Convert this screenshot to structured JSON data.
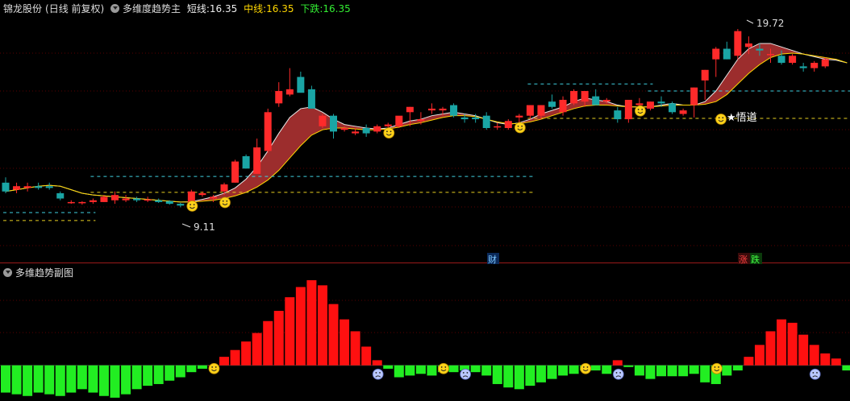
{
  "header": {
    "stock_name": "锦龙股份",
    "period": "(日线 前复权)",
    "indicator": "多维度趋势主",
    "short_label": "短线:",
    "short_value": "16.35",
    "mid_label": "中线:",
    "mid_value": "16.35",
    "down_label": "下跌:",
    "down_value": "16.35"
  },
  "sub_header": {
    "indicator": "多维趋势副图"
  },
  "annotations": {
    "high_label": "19.72",
    "low_label": "9.11",
    "star_label": "★悟道",
    "cai_marker": "财",
    "zhang_marker": "涨",
    "die_marker": "跌"
  },
  "colors": {
    "up": "#ff2a2a",
    "down": "#1aa5a5",
    "bar_up": "#ff1010",
    "bar_down": "#22ee22",
    "band": "#9c2d2d"
  },
  "chart_data": [
    {
      "type": "candlestick",
      "title": "锦龙股份 (日线 前复权)",
      "ylim": [
        7.2,
        21.0
      ],
      "candles": [
        {
          "o": 11.0,
          "h": 11.3,
          "l": 10.4,
          "c": 10.5
        },
        {
          "o": 10.6,
          "h": 11.0,
          "l": 10.4,
          "c": 10.8
        },
        {
          "o": 10.7,
          "h": 11.0,
          "l": 10.5,
          "c": 10.8
        },
        {
          "o": 10.8,
          "h": 11.0,
          "l": 10.6,
          "c": 10.7
        },
        {
          "o": 10.8,
          "h": 11.0,
          "l": 10.6,
          "c": 10.7
        },
        {
          "o": 10.4,
          "h": 10.5,
          "l": 10.0,
          "c": 10.1
        },
        {
          "o": 9.9,
          "h": 10.0,
          "l": 9.8,
          "c": 9.9
        },
        {
          "o": 9.85,
          "h": 9.95,
          "l": 9.75,
          "c": 9.9
        },
        {
          "o": 9.9,
          "h": 10.1,
          "l": 9.8,
          "c": 10.0
        },
        {
          "o": 9.9,
          "h": 10.3,
          "l": 9.9,
          "c": 10.2
        },
        {
          "o": 10.0,
          "h": 10.5,
          "l": 9.8,
          "c": 10.3
        },
        {
          "o": 10.0,
          "h": 10.3,
          "l": 9.9,
          "c": 10.1
        },
        {
          "o": 10.1,
          "h": 10.2,
          "l": 9.9,
          "c": 10.0
        },
        {
          "o": 10.0,
          "h": 10.2,
          "l": 9.9,
          "c": 10.05
        },
        {
          "o": 10.0,
          "h": 10.1,
          "l": 9.85,
          "c": 9.9
        },
        {
          "o": 9.95,
          "h": 10.0,
          "l": 9.75,
          "c": 9.8
        },
        {
          "o": 9.8,
          "h": 9.85,
          "l": 9.6,
          "c": 9.7
        },
        {
          "o": 9.7,
          "h": 10.6,
          "l": 9.6,
          "c": 10.5
        },
        {
          "o": 10.3,
          "h": 10.5,
          "l": 10.2,
          "c": 10.4
        },
        {
          "o": 10.1,
          "h": 10.3,
          "l": 9.9,
          "c": 10.2
        },
        {
          "o": 10.5,
          "h": 11.0,
          "l": 10.3,
          "c": 10.9
        },
        {
          "o": 11.0,
          "h": 12.3,
          "l": 11.0,
          "c": 12.2
        },
        {
          "o": 12.5,
          "h": 12.6,
          "l": 11.8,
          "c": 11.8
        },
        {
          "o": 11.5,
          "h": 13.5,
          "l": 11.5,
          "c": 13.0
        },
        {
          "o": 12.8,
          "h": 15.2,
          "l": 12.7,
          "c": 15.0
        },
        {
          "o": 15.5,
          "h": 16.7,
          "l": 15.3,
          "c": 16.2
        },
        {
          "o": 16.0,
          "h": 17.5,
          "l": 15.9,
          "c": 16.3
        },
        {
          "o": 17.0,
          "h": 17.3,
          "l": 16.2,
          "c": 16.1
        },
        {
          "o": 16.3,
          "h": 16.5,
          "l": 15.2,
          "c": 15.2
        },
        {
          "o": 14.2,
          "h": 14.9,
          "l": 14.1,
          "c": 14.8
        },
        {
          "o": 14.8,
          "h": 14.9,
          "l": 13.5,
          "c": 13.9
        },
        {
          "o": 14.0,
          "h": 14.2,
          "l": 13.9,
          "c": 14.1
        },
        {
          "o": 13.8,
          "h": 14.1,
          "l": 13.7,
          "c": 13.9
        },
        {
          "o": 14.1,
          "h": 14.3,
          "l": 13.6,
          "c": 13.8
        },
        {
          "o": 13.9,
          "h": 14.3,
          "l": 13.8,
          "c": 14.2
        },
        {
          "o": 14.2,
          "h": 14.4,
          "l": 14.0,
          "c": 14.3
        },
        {
          "o": 14.2,
          "h": 14.7,
          "l": 14.1,
          "c": 14.8
        },
        {
          "o": 15.0,
          "h": 15.3,
          "l": 14.2,
          "c": 15.3
        },
        {
          "o": 14.5,
          "h": 15.0,
          "l": 14.3,
          "c": 14.6
        },
        {
          "o": 15.1,
          "h": 15.5,
          "l": 14.9,
          "c": 15.2
        },
        {
          "o": 15.1,
          "h": 15.3,
          "l": 14.8,
          "c": 15.2
        },
        {
          "o": 15.4,
          "h": 15.5,
          "l": 14.7,
          "c": 14.8
        },
        {
          "o": 14.7,
          "h": 14.9,
          "l": 14.4,
          "c": 14.6
        },
        {
          "o": 14.7,
          "h": 14.9,
          "l": 14.4,
          "c": 14.6
        },
        {
          "o": 14.8,
          "h": 15.0,
          "l": 14.0,
          "c": 14.1
        },
        {
          "o": 14.2,
          "h": 14.4,
          "l": 14.0,
          "c": 14.2
        },
        {
          "o": 14.1,
          "h": 14.6,
          "l": 14.0,
          "c": 14.5
        },
        {
          "o": 14.7,
          "h": 14.9,
          "l": 14.4,
          "c": 14.8
        },
        {
          "o": 14.8,
          "h": 15.4,
          "l": 14.6,
          "c": 15.4
        },
        {
          "o": 14.8,
          "h": 15.4,
          "l": 14.6,
          "c": 15.4
        },
        {
          "o": 15.6,
          "h": 16.0,
          "l": 15.2,
          "c": 15.3
        },
        {
          "o": 15.0,
          "h": 15.9,
          "l": 14.8,
          "c": 15.7
        },
        {
          "o": 15.5,
          "h": 16.3,
          "l": 15.4,
          "c": 16.2
        },
        {
          "o": 15.6,
          "h": 16.2,
          "l": 15.3,
          "c": 16.2
        },
        {
          "o": 15.9,
          "h": 16.3,
          "l": 15.4,
          "c": 15.4
        },
        {
          "o": 15.6,
          "h": 15.8,
          "l": 15.5,
          "c": 15.7
        },
        {
          "o": 15.1,
          "h": 15.3,
          "l": 14.4,
          "c": 14.6
        },
        {
          "o": 14.6,
          "h": 15.6,
          "l": 14.4,
          "c": 15.7
        },
        {
          "o": 15.4,
          "h": 15.8,
          "l": 15.3,
          "c": 15.5
        },
        {
          "o": 15.2,
          "h": 15.6,
          "l": 15.1,
          "c": 15.6
        },
        {
          "o": 15.6,
          "h": 15.9,
          "l": 15.3,
          "c": 15.5
        },
        {
          "o": 15.5,
          "h": 15.6,
          "l": 14.9,
          "c": 15.0
        },
        {
          "o": 14.9,
          "h": 15.2,
          "l": 14.8,
          "c": 15.1
        },
        {
          "o": 15.4,
          "h": 16.4,
          "l": 14.7,
          "c": 16.4
        },
        {
          "o": 16.8,
          "h": 17.4,
          "l": 15.7,
          "c": 17.4
        },
        {
          "o": 18.0,
          "h": 18.7,
          "l": 17.0,
          "c": 18.6
        },
        {
          "o": 18.6,
          "h": 19.0,
          "l": 18.0,
          "c": 18.0
        },
        {
          "o": 18.2,
          "h": 19.72,
          "l": 18.0,
          "c": 19.6
        },
        {
          "o": 18.7,
          "h": 19.3,
          "l": 18.3,
          "c": 18.9
        },
        {
          "o": 18.6,
          "h": 18.9,
          "l": 18.2,
          "c": 18.5
        },
        {
          "o": 18.3,
          "h": 18.6,
          "l": 17.8,
          "c": 18.3
        },
        {
          "o": 18.2,
          "h": 18.5,
          "l": 17.7,
          "c": 17.8
        },
        {
          "o": 17.8,
          "h": 18.3,
          "l": 17.7,
          "c": 18.2
        },
        {
          "o": 17.6,
          "h": 17.8,
          "l": 17.3,
          "c": 17.5
        },
        {
          "o": 17.5,
          "h": 17.9,
          "l": 17.3,
          "c": 17.8
        },
        {
          "o": 17.6,
          "h": 18.1,
          "l": 17.5,
          "c": 18.0
        }
      ],
      "fast_line": [
        10.5,
        10.6,
        10.7,
        10.8,
        10.85,
        10.8,
        10.6,
        10.4,
        10.3,
        10.25,
        10.2,
        10.15,
        10.1,
        10.05,
        10.0,
        9.95,
        9.9,
        9.92,
        10.05,
        10.2,
        10.4,
        10.7,
        11.2,
        11.9,
        12.8,
        13.8,
        14.7,
        15.2,
        15.3,
        15.0,
        14.6,
        14.3,
        14.2,
        14.1,
        14.05,
        14.1,
        14.3,
        14.5,
        14.6,
        14.8,
        14.9,
        15.0,
        14.9,
        14.8,
        14.6,
        14.4,
        14.3,
        14.4,
        14.6,
        14.9,
        15.1,
        15.3,
        15.6,
        15.8,
        15.7,
        15.6,
        15.4,
        15.3,
        15.3,
        15.3,
        15.4,
        15.5,
        15.4,
        15.4,
        15.6,
        16.2,
        17.1,
        18.0,
        18.6,
        18.9,
        18.9,
        18.7,
        18.5,
        18.3,
        18.15,
        18.0,
        17.95,
        17.8
      ],
      "slow_line": [
        10.5,
        10.6,
        10.7,
        10.8,
        10.85,
        10.8,
        10.6,
        10.4,
        10.3,
        10.25,
        10.2,
        10.15,
        10.1,
        10.05,
        10.0,
        9.95,
        9.9,
        9.9,
        9.95,
        10.0,
        10.1,
        10.25,
        10.45,
        10.75,
        11.15,
        11.7,
        12.4,
        13.1,
        13.7,
        14.0,
        14.1,
        14.1,
        14.05,
        14.0,
        14.0,
        14.05,
        14.15,
        14.3,
        14.4,
        14.55,
        14.7,
        14.8,
        14.8,
        14.75,
        14.6,
        14.45,
        14.35,
        14.35,
        14.45,
        14.6,
        14.8,
        15.0,
        15.2,
        15.35,
        15.4,
        15.4,
        15.35,
        15.3,
        15.3,
        15.3,
        15.35,
        15.4,
        15.4,
        15.4,
        15.45,
        15.6,
        16.0,
        16.6,
        17.2,
        17.7,
        18.1,
        18.3,
        18.35,
        18.3,
        18.2,
        18.1,
        18.0,
        17.8
      ],
      "dashed_levels": [
        {
          "value": 9.3,
          "from": 0,
          "to": 8,
          "color": "cyan"
        },
        {
          "value": 8.85,
          "from": 0,
          "to": 8,
          "color": "yellow"
        },
        {
          "value": 11.35,
          "from": 8,
          "to": 48,
          "color": "cyan"
        },
        {
          "value": 10.45,
          "from": 8,
          "to": 48,
          "color": "yellow"
        },
        {
          "value": 16.6,
          "from": 48,
          "to": 59,
          "color": "cyan"
        },
        {
          "value": 16.2,
          "from": 59,
          "to": 78,
          "color": "cyan"
        },
        {
          "value": 14.65,
          "from": 48,
          "to": 78,
          "color": "yellow"
        }
      ],
      "smile_markers": [
        17,
        20,
        35,
        47,
        58
      ],
      "high": 19.72,
      "low": 9.11
    },
    {
      "type": "bar",
      "title": "多维趋势副图",
      "ylim": [
        -10,
        25
      ],
      "values": [
        -8,
        -8.5,
        -9,
        -8,
        -8.5,
        -9,
        -8,
        -7,
        -8,
        -9,
        -9.5,
        -8.5,
        -7,
        -6,
        -5.5,
        -4.5,
        -3.5,
        -2,
        -1,
        0,
        2.5,
        4.5,
        7,
        9.5,
        13,
        16,
        20,
        23,
        25,
        23.5,
        18,
        13.5,
        10,
        5.5,
        1.5,
        -1,
        -3.5,
        -3,
        -2.5,
        -3,
        -2,
        -2,
        -1.5,
        -2,
        -3,
        -5.5,
        -6.5,
        -7,
        -6,
        -5,
        -4,
        -3,
        -2.5,
        -1.5,
        -1.5,
        -2.5,
        1.5,
        -0.5,
        -3,
        -4,
        -3.2,
        -3.2,
        -3.2,
        -2.5,
        -5,
        -5.5,
        -3,
        -1.5,
        2.5,
        6,
        10,
        13.5,
        12.5,
        9,
        6,
        3.5,
        2,
        -1.5,
        -2.5
      ]
    }
  ]
}
